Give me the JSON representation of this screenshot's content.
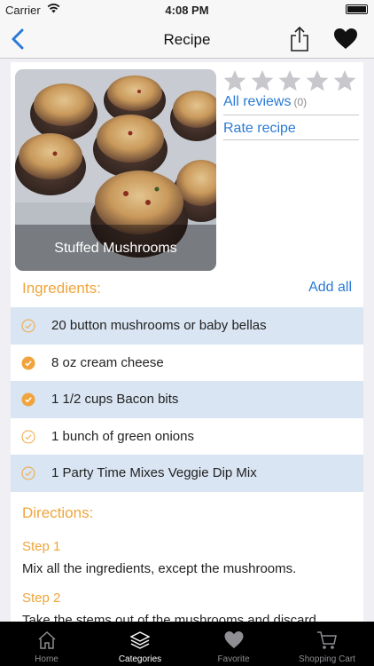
{
  "status_bar": {
    "carrier": "Carrier",
    "time": "4:08 PM"
  },
  "nav": {
    "title": "Recipe"
  },
  "recipe": {
    "name": "Stuffed Mushrooms",
    "rating_stars": 0,
    "all_reviews_label": "All reviews",
    "review_count": "(0)",
    "rate_label": "Rate recipe"
  },
  "ingredients": {
    "title": "Ingredients:",
    "add_all_label": "Add all",
    "items": [
      {
        "label": "20 button mushrooms or baby bellas",
        "checked": false
      },
      {
        "label": "8 oz cream cheese",
        "checked": true
      },
      {
        "label": "1 1/2 cups Bacon bits",
        "checked": true
      },
      {
        "label": "1 bunch of green onions",
        "checked": false
      },
      {
        "label": "1 Party Time Mixes Veggie Dip Mix",
        "checked": false
      }
    ]
  },
  "directions": {
    "title": "Directions:",
    "steps": [
      {
        "title": "Step 1",
        "text": "Mix all the ingredients, except the mushrooms."
      },
      {
        "title": "Step 2",
        "text": "Take the stems out of the mushrooms and discard."
      }
    ]
  },
  "tab_bar": {
    "tabs": [
      {
        "label": "Home",
        "icon": "home-icon"
      },
      {
        "label": "Categories",
        "icon": "categories-icon"
      },
      {
        "label": "Favorite",
        "icon": "heart-icon"
      },
      {
        "label": "Shopping Cart",
        "icon": "cart-icon"
      }
    ],
    "active": "Categories"
  },
  "colors": {
    "accent_blue": "#2a7ad5",
    "accent_orange": "#f0a43b",
    "row_shade": "#d9e5f2"
  }
}
